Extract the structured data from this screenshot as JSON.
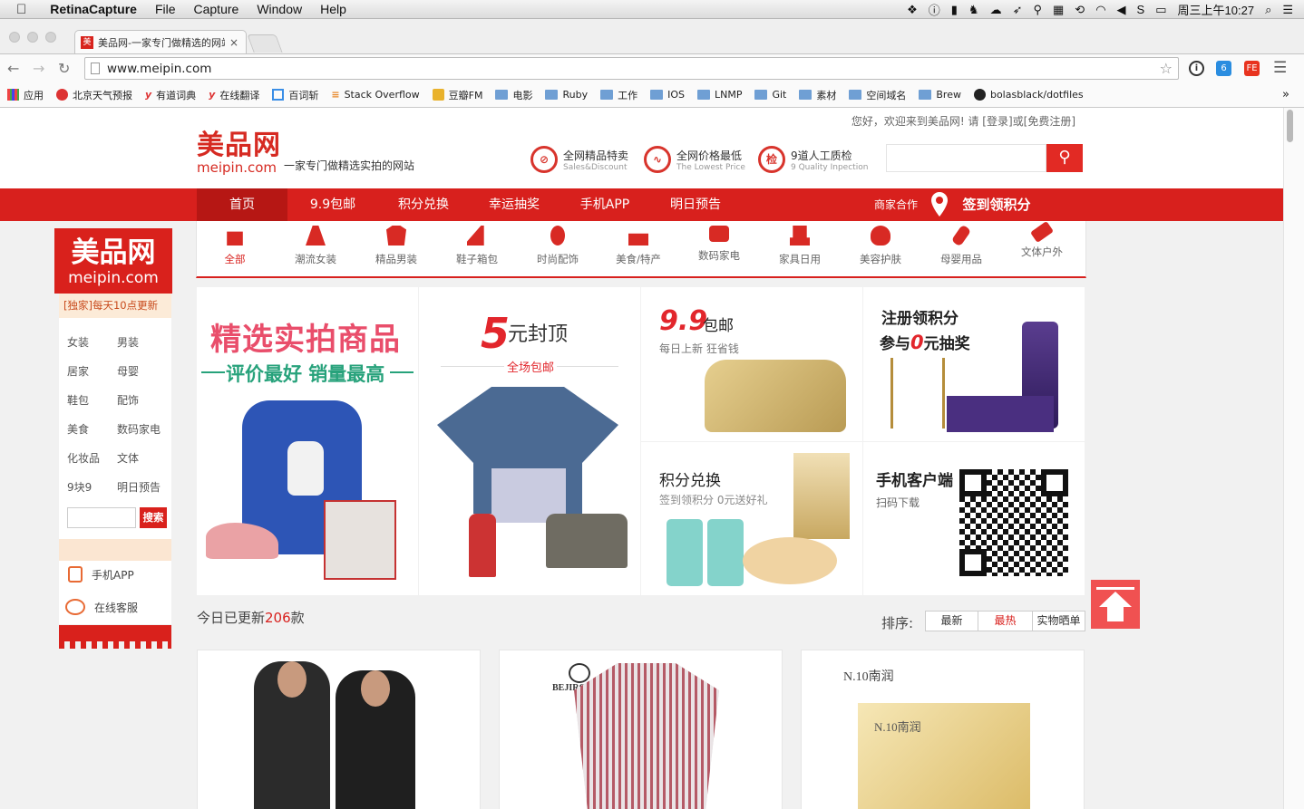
{
  "menubar": {
    "app": "RetinaCapture",
    "menus": [
      "File",
      "Capture",
      "Window",
      "Help"
    ],
    "clock": "周三上午10:27"
  },
  "tab": {
    "favicon": "美",
    "title": "美品网-一家专门做精选的网站",
    "close": "×"
  },
  "url": "www.meipin.com",
  "bookmarks": [
    "应用",
    "北京天气预报",
    "有道词典",
    "在线翻译",
    "百词斩",
    "Stack Overflow",
    "豆瓣FM",
    "电影",
    "Ruby",
    "工作",
    "IOS",
    "LNMP",
    "Git",
    "素材",
    "空间域名",
    "Brew",
    "bolasblack/dotfiles"
  ],
  "bookmarks_more": "»",
  "header": {
    "welcome": "您好，欢迎来到美品网! 请 [登录]或[免费注册]",
    "logo_cn": "美品网",
    "logo_en": "meipin.com",
    "slogan": "一家专门做精选实拍的网站",
    "features": [
      {
        "icon": "tag-icon",
        "glyph": "⊘",
        "title": "全网精品特卖",
        "sub": "Sales&Discount"
      },
      {
        "icon": "price-wave-icon",
        "glyph": "∿",
        "title": "全网价格最低",
        "sub": "The Lowest Price"
      },
      {
        "icon": "quality-check-icon",
        "glyph": "检",
        "title": "9道人工质检",
        "sub": "9 Quality Inpection"
      }
    ],
    "search_placeholder": "",
    "search_icon": "search-icon"
  },
  "nav": {
    "items": [
      "首页",
      "9.9包邮",
      "积分兑换",
      "幸运抽奖",
      "手机APP",
      "明日预告"
    ],
    "merchant": "商家合作",
    "signin": "签到领积分"
  },
  "categories": [
    "全部",
    "潮流女装",
    "精品男装",
    "鞋子箱包",
    "时尚配饰",
    "美食/特产",
    "数码家电",
    "家具日用",
    "美容护肤",
    "母婴用品",
    "文体户外"
  ],
  "sidebar": {
    "logo_cn": "美品网",
    "logo_en": "meipin.com",
    "tagline": "[独家]每天10点更新",
    "links": [
      [
        "女装",
        "男装"
      ],
      [
        "居家",
        "母婴"
      ],
      [
        "鞋包",
        "配饰"
      ],
      [
        "美食",
        "数码家电"
      ],
      [
        "化妆品",
        "文体"
      ],
      [
        "9块9",
        "明日预告"
      ]
    ],
    "search_btn": "搜索",
    "app": "手机APP",
    "service": "在线客服"
  },
  "banners": {
    "b1_title": "精选实拍商品",
    "b1_sub": "评价最好 销量最高",
    "b2_num": "5",
    "b2_title": "元封顶",
    "b2_sub": "全场包邮",
    "b3_num": "9.9",
    "b3_title": "包邮",
    "b3_sub": "每日上新 狂省钱",
    "b4_line1": "注册领积分",
    "b4_line2a": "参与",
    "b4_line2b": "0",
    "b4_line2c": "元抽奖",
    "b5_title": "积分兑换",
    "b5_sub": "签到领积分 0元送好礼",
    "b6_title": "手机客户端",
    "b6_sub": "扫码下载"
  },
  "updates": {
    "prefix": "今日已更新",
    "count": "206",
    "suffix": "款"
  },
  "sort": {
    "label": "排序:",
    "options": [
      "最新",
      "最热",
      "实物晒单"
    ]
  },
  "products": [
    {
      "brand": ""
    },
    {
      "brand": "BEJIROG"
    },
    {
      "brand": "N.10南润"
    }
  ],
  "colors": {
    "brand_red": "#d8201d",
    "accent_pink": "#e94e6b",
    "green": "#27a27b"
  }
}
